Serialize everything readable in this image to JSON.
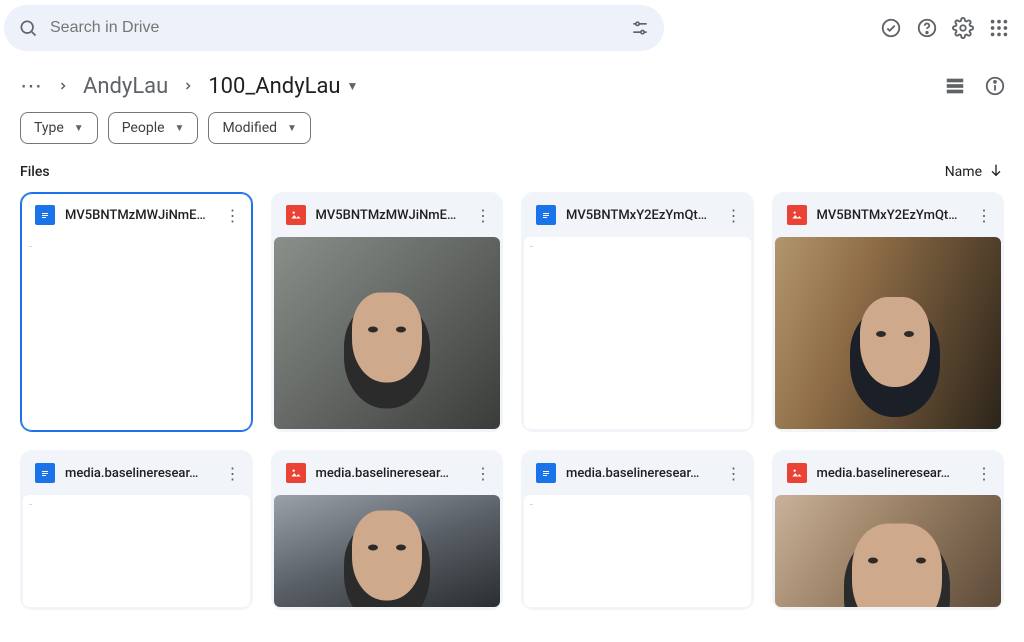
{
  "header": {
    "search_placeholder": "Search in Drive"
  },
  "breadcrumb": {
    "parent": "AndyLau",
    "current": "100_AndyLau"
  },
  "filters": {
    "type": "Type",
    "people": "People",
    "modified": "Modified"
  },
  "section": {
    "label": "Files",
    "sort_by": "Name"
  },
  "files": [
    {
      "name": "MV5BNTMzMWJiNmE…",
      "type": "doc",
      "thumb": "blank",
      "selected": true
    },
    {
      "name": "MV5BNTMzMWJiNmE…",
      "type": "image",
      "thumb": "photo1"
    },
    {
      "name": "MV5BNTMxY2EzYmQt…",
      "type": "doc",
      "thumb": "blank"
    },
    {
      "name": "MV5BNTMxY2EzYmQt…",
      "type": "image",
      "thumb": "photo2"
    },
    {
      "name": "media.baselineresear…",
      "type": "doc",
      "thumb": "blank"
    },
    {
      "name": "media.baselineresear…",
      "type": "image",
      "thumb": "photo3"
    },
    {
      "name": "media.baselineresear…",
      "type": "doc",
      "thumb": "blank"
    },
    {
      "name": "media.baselineresear…",
      "type": "image",
      "thumb": "photo4"
    }
  ]
}
